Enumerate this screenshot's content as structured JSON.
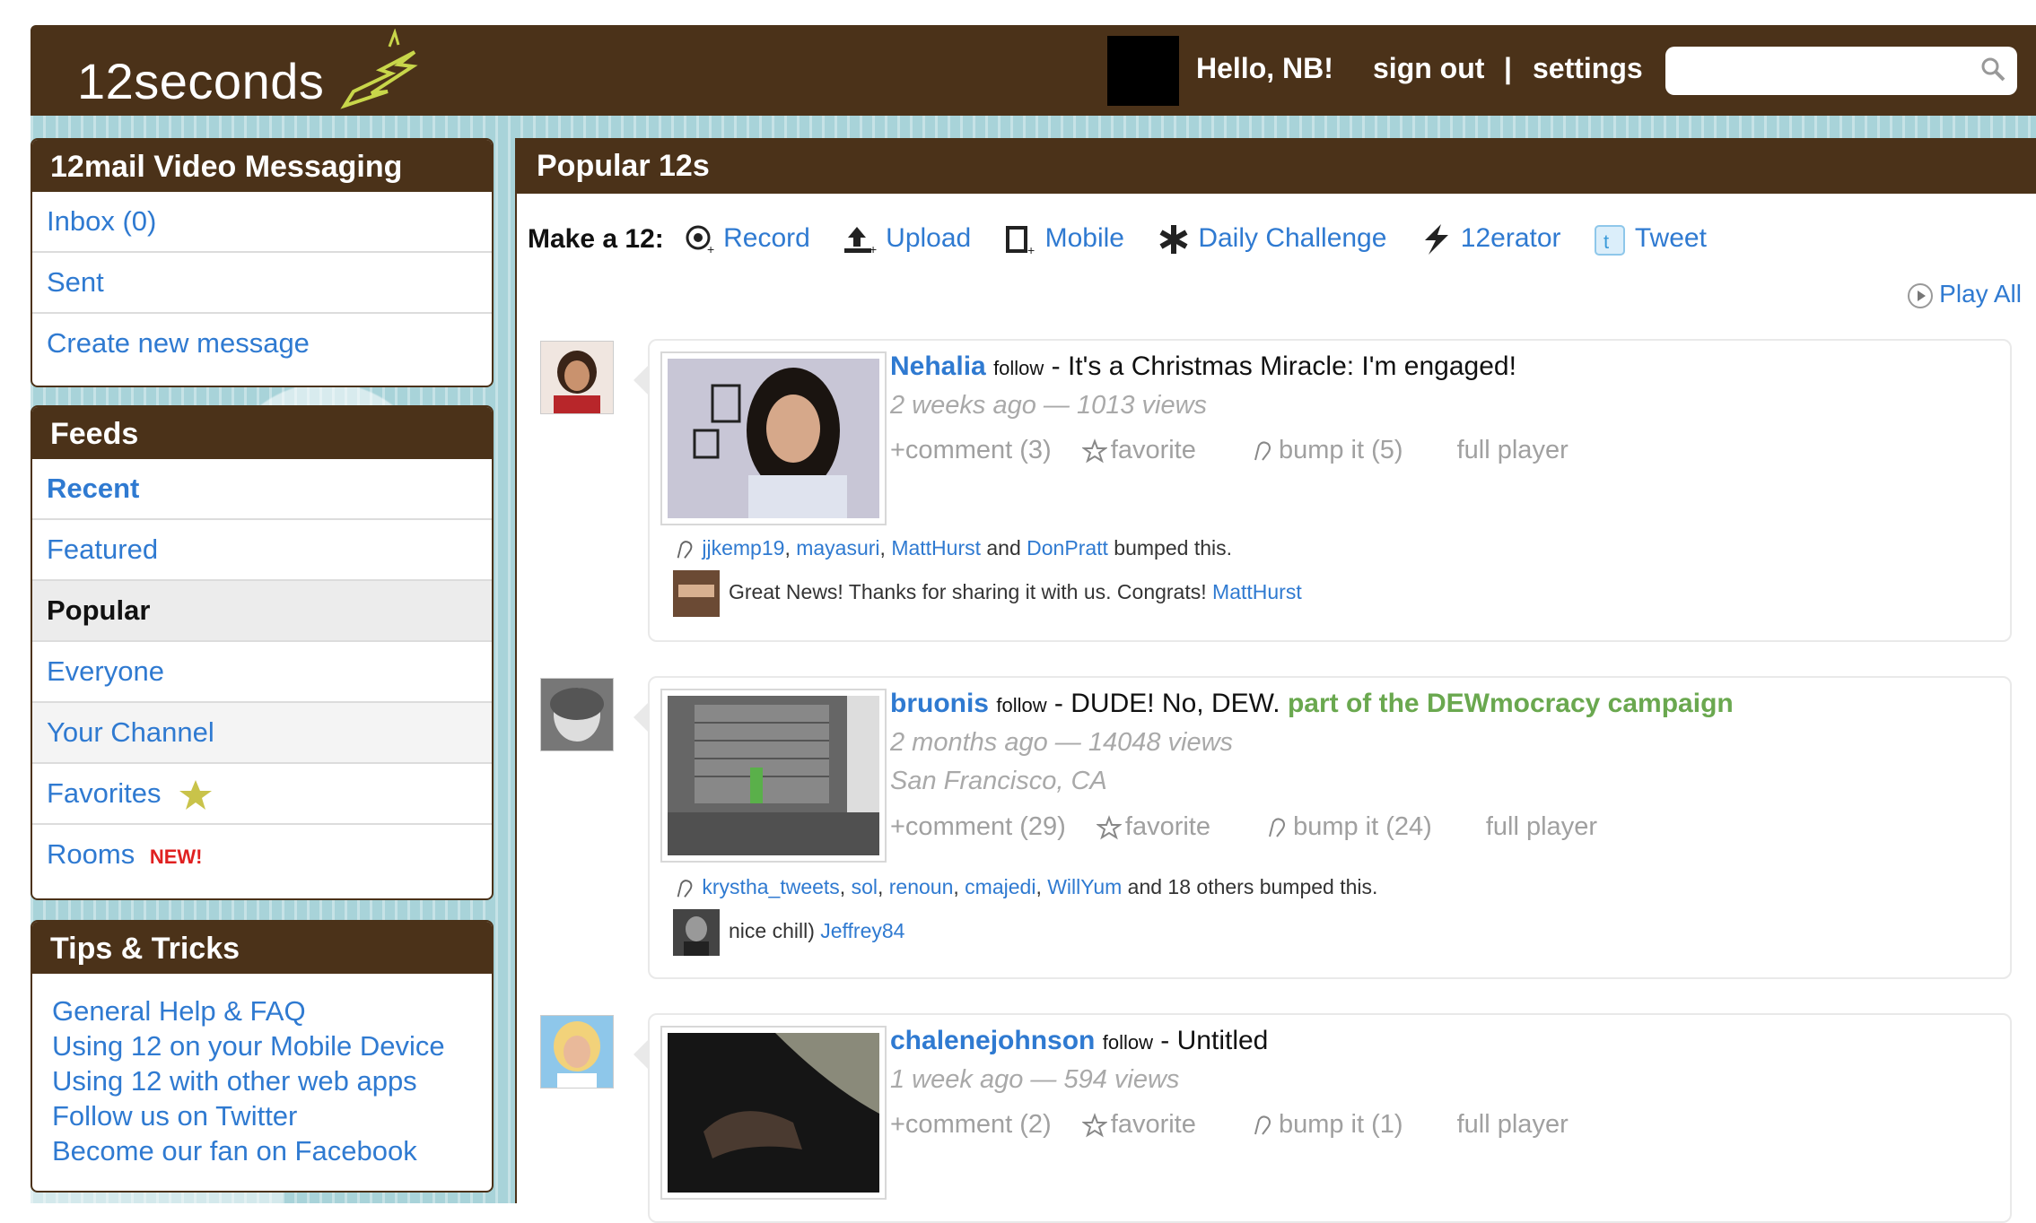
{
  "header": {
    "logo_text": "12seconds",
    "greeting": "Hello, NB!",
    "sign_out": "sign out",
    "separator": "|",
    "settings": "settings",
    "search_placeholder": ""
  },
  "mail_panel": {
    "title": "12mail Video Messaging",
    "items": [
      "Inbox (0)",
      "Sent",
      "Create new message"
    ]
  },
  "feeds_panel": {
    "title": "Feeds",
    "items": [
      "Recent",
      "Featured",
      "Popular",
      "Everyone",
      "Your Channel",
      "Favorites",
      "Rooms"
    ],
    "new_badge": "NEW!"
  },
  "tips_panel": {
    "title": "Tips & Tricks",
    "links": [
      "General Help & FAQ",
      "Using 12 on your Mobile Device",
      "Using 12 with other web apps",
      "Follow us on Twitter",
      "Become our fan on Facebook"
    ]
  },
  "main": {
    "title": "Popular 12s",
    "make_label": "Make a 12:",
    "make_items": [
      "Record",
      "Upload",
      "Mobile",
      "Daily Challenge",
      "12erator",
      "Tweet"
    ],
    "play_all": "Play All"
  },
  "items": [
    {
      "user": "Nehalia",
      "follow": "follow",
      "title": " - It's a Christmas Miracle: I'm engaged!",
      "campaign": "",
      "meta1": "2 weeks ago — 1013 views",
      "meta2": "",
      "comment": "+comment (3)",
      "favorite": "favorite",
      "bump": "bump it (5)",
      "full_player": "full player",
      "bumpers": [
        "jjkemp19",
        "mayasuri",
        "MattHurst",
        "DonPratt"
      ],
      "bump_sep1": ", ",
      "bump_sep2": ", ",
      "bump_and": " and ",
      "bump_suffix": " bumped this.",
      "comment_text": "Great News! Thanks for sharing it with us. Congrats! ",
      "comment_user": "MattHurst"
    },
    {
      "user": "bruonis",
      "follow": "follow",
      "title": " - DUDE! No, DEW. ",
      "campaign": "part of the DEWmocracy campaign",
      "meta1": "2 months ago — 14048 views",
      "meta2": "San Francisco, CA",
      "comment": "+comment (29)",
      "favorite": "favorite",
      "bump": "bump it (24)",
      "full_player": "full player",
      "bumpers": [
        "krystha_tweets",
        "sol",
        "renoun",
        "cmajedi",
        "WillYum"
      ],
      "bump_suffix": " and 18 others bumped this.",
      "comment_text": "nice chill) ",
      "comment_user": "Jeffrey84"
    },
    {
      "user": "chalenejohnson",
      "follow": "follow",
      "title": " - Untitled",
      "campaign": "",
      "meta1": "1 week ago — 594 views",
      "meta2": "",
      "comment": "+comment (2)",
      "favorite": "favorite",
      "bump": "bump it (1)",
      "full_player": "full player"
    }
  ],
  "colors": {
    "brand_brown": "#4b3219",
    "link_blue": "#2f7ad1",
    "background_teal": "#a8d3d9",
    "campaign_green": "#6aa84f",
    "new_red": "#e02020"
  }
}
